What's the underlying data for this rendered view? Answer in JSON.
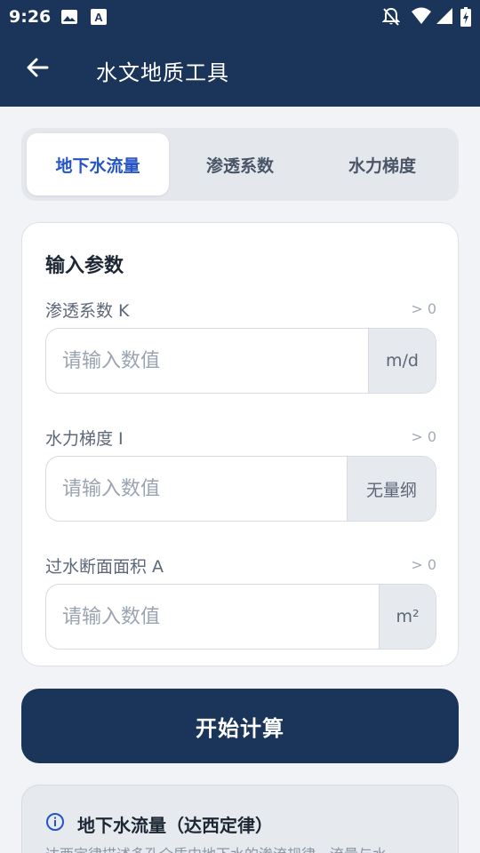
{
  "status_bar": {
    "time": "9:26",
    "left_icons": [
      "image-icon",
      "accessibility-a-icon"
    ],
    "right_icons": [
      "notifications-off-icon",
      "wifi-icon",
      "signal-icon",
      "battery-charging-icon"
    ]
  },
  "app_bar": {
    "title": "水文地质工具",
    "back_icon": "arrow-left-icon"
  },
  "tabs": [
    {
      "label": "地下水流量",
      "active": true
    },
    {
      "label": "渗透系数",
      "active": false
    },
    {
      "label": "水力梯度",
      "active": false
    }
  ],
  "input_card": {
    "title": "输入参数",
    "fields": [
      {
        "label": "渗透系数 K",
        "hint": "> 0",
        "placeholder": "请输入数值",
        "value": "",
        "unit": "m/d"
      },
      {
        "label": "水力梯度 I",
        "hint": "> 0",
        "placeholder": "请输入数值",
        "value": "",
        "unit": "无量纲"
      },
      {
        "label": "过水断面面积 A",
        "hint": "> 0",
        "placeholder": "请输入数值",
        "value": "",
        "unit": "m²"
      }
    ]
  },
  "calculate_button": {
    "label": "开始计算"
  },
  "info_card": {
    "icon": "info-icon",
    "title": "地下水流量（达西定律）",
    "description": "达西定律描述多孔介质中地下水的渗流规律，流量与水"
  },
  "colors": {
    "primary": "#1b3459",
    "accent": "#2554c7",
    "background": "#f1f3f6",
    "card": "#ffffff",
    "unit_bg": "#e6e9ee"
  }
}
